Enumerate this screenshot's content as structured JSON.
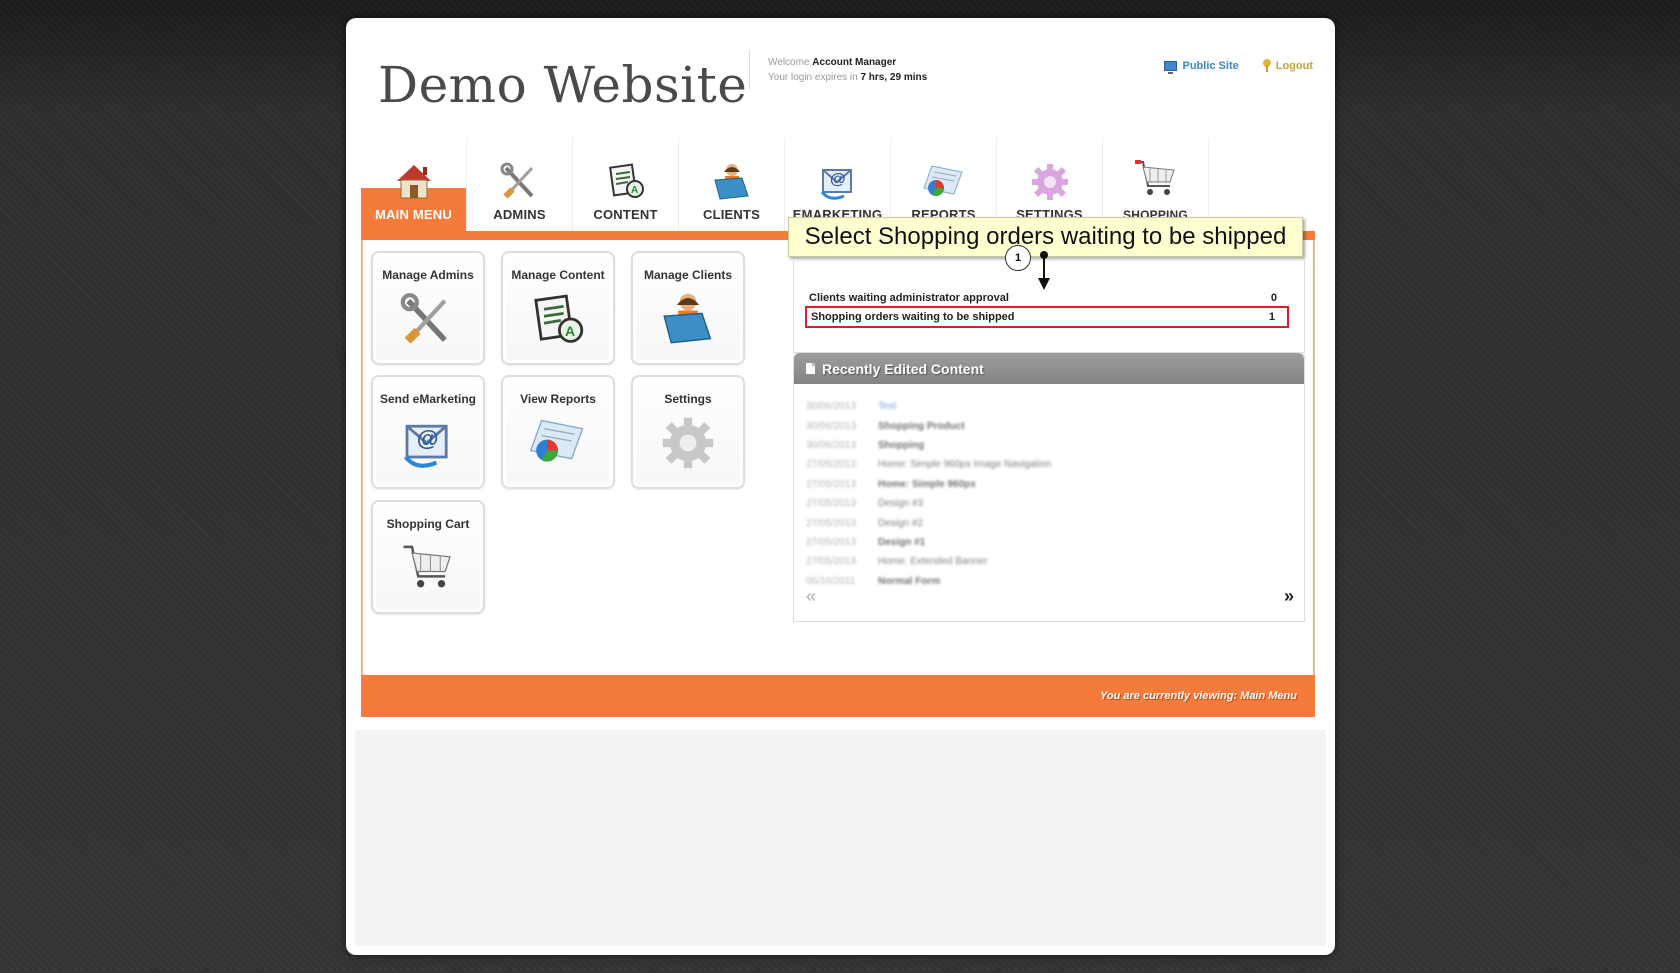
{
  "header": {
    "site_title": "Demo Website",
    "welcome_prefix": "Welcome",
    "user_name": "Account Manager",
    "expires_prefix": "Your login expires in",
    "expires_value": "7 hrs, 29 mins",
    "public_site": "Public Site",
    "logout": "Logout"
  },
  "nav": [
    {
      "label": "MAIN MENU",
      "icon": "house-icon",
      "active": true
    },
    {
      "label": "ADMINS",
      "icon": "tools-icon"
    },
    {
      "label": "CONTENT",
      "icon": "document-icon"
    },
    {
      "label": "CLIENTS",
      "icon": "client-folder-icon"
    },
    {
      "label": "EMARKETING",
      "icon": "email-icon"
    },
    {
      "label": "REPORTS",
      "icon": "report-chart-icon"
    },
    {
      "label": "SETTINGS",
      "icon": "gear-icon"
    },
    {
      "label": "SHOPPING",
      "icon": "shopping-cart-icon"
    }
  ],
  "tiles": [
    {
      "label": "Manage Admins",
      "icon": "tools-icon"
    },
    {
      "label": "Manage Content",
      "icon": "document-icon"
    },
    {
      "label": "Manage Clients",
      "icon": "client-folder-icon"
    },
    {
      "label": "Send eMarketing",
      "icon": "email-icon"
    },
    {
      "label": "View Reports",
      "icon": "report-chart-icon"
    },
    {
      "label": "Settings",
      "icon": "gear-icon"
    },
    {
      "label": "Shopping Cart",
      "icon": "shopping-cart-icon"
    }
  ],
  "callout": {
    "text": "Select Shopping orders waiting to be shipped",
    "step": "1"
  },
  "stats": [
    {
      "label": "Clients waiting administrator approval",
      "value": "0"
    },
    {
      "label": "Shopping orders waiting to be shipped",
      "value": "1"
    }
  ],
  "recent": {
    "title": "Recently Edited Content",
    "items": [
      {
        "date": "30/06/2013",
        "name": "Test",
        "style": "link"
      },
      {
        "date": "30/06/2013",
        "name": "Shopping Product",
        "style": "bold"
      },
      {
        "date": "30/06/2013",
        "name": "Shopping",
        "style": "bold"
      },
      {
        "date": "27/05/2013",
        "name": "Home: Simple 960px Image Navigation",
        "style": ""
      },
      {
        "date": "27/05/2013",
        "name": "Home: Simple 960px",
        "style": "bold"
      },
      {
        "date": "27/05/2013",
        "name": "Design #3",
        "style": ""
      },
      {
        "date": "27/05/2013",
        "name": "Design #2",
        "style": ""
      },
      {
        "date": "27/05/2013",
        "name": "Design #1",
        "style": "bold"
      },
      {
        "date": "27/05/2013",
        "name": "Home: Extended Banner",
        "style": ""
      },
      {
        "date": "05/10/2011",
        "name": "Normal Form",
        "style": "bold"
      }
    ],
    "prev": "«",
    "next": "»"
  },
  "footer": {
    "text": "You are currently viewing: Main Menu"
  }
}
